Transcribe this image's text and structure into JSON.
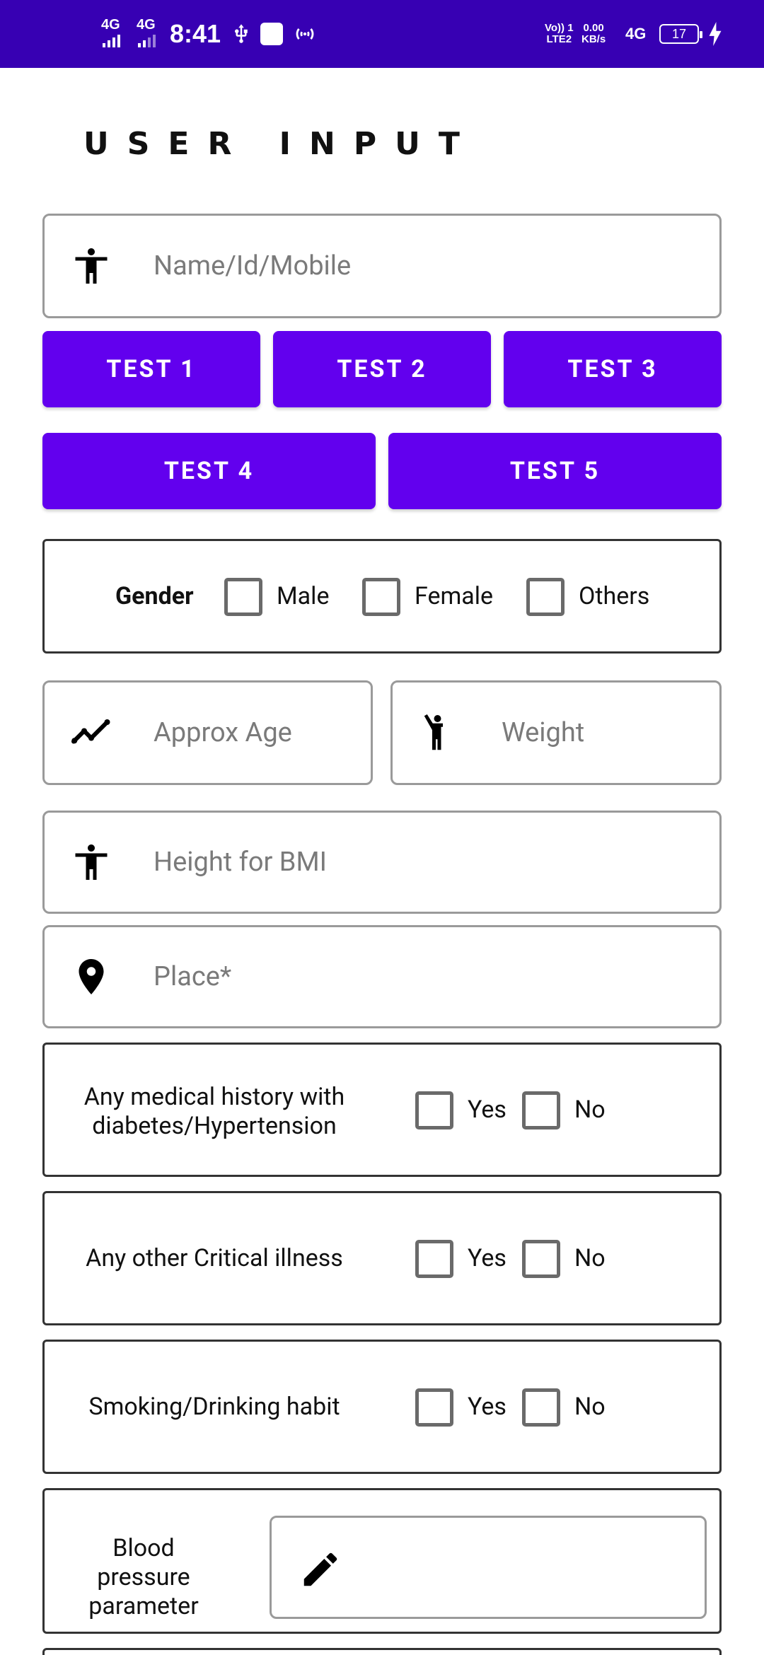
{
  "status_bar": {
    "net1": "4G",
    "net2": "4G",
    "time": "8:41",
    "volte_top": "Vo)) 1",
    "volte_bottom": "LTE2",
    "speed_value": "0.00",
    "speed_unit": "KB/s",
    "net3": "4G",
    "battery": "17"
  },
  "title": "USER INPUT",
  "name_field": {
    "placeholder": "Name/Id/Mobile",
    "icon": "accessibility-icon"
  },
  "test_buttons": [
    "TEST 1",
    "TEST 2",
    "TEST 3",
    "TEST 4",
    "TEST 5"
  ],
  "gender": {
    "label": "Gender",
    "options": [
      "Male",
      "Female",
      "Others"
    ]
  },
  "age_field": {
    "placeholder": "Approx Age",
    "icon": "trending-icon"
  },
  "weight_field": {
    "placeholder": "Weight",
    "icon": "person-waving-icon"
  },
  "height_field": {
    "placeholder": "Height for BMI",
    "icon": "accessibility-icon"
  },
  "place_field": {
    "placeholder": "Place*",
    "icon": "location-pin-icon"
  },
  "questions": [
    {
      "label": "Any medical history with diabetes/Hypertension",
      "yes": "Yes",
      "no": "No"
    },
    {
      "label": "Any other Critical illness",
      "yes": "Yes",
      "no": "No"
    },
    {
      "label": "Smoking/Drinking habit",
      "yes": "Yes",
      "no": "No"
    }
  ],
  "blood_pressure": {
    "label": "Blood pressure parameter",
    "icon": "pencil-icon"
  },
  "colors": {
    "status_bar": "#3700B3",
    "button": "#6200EE"
  }
}
